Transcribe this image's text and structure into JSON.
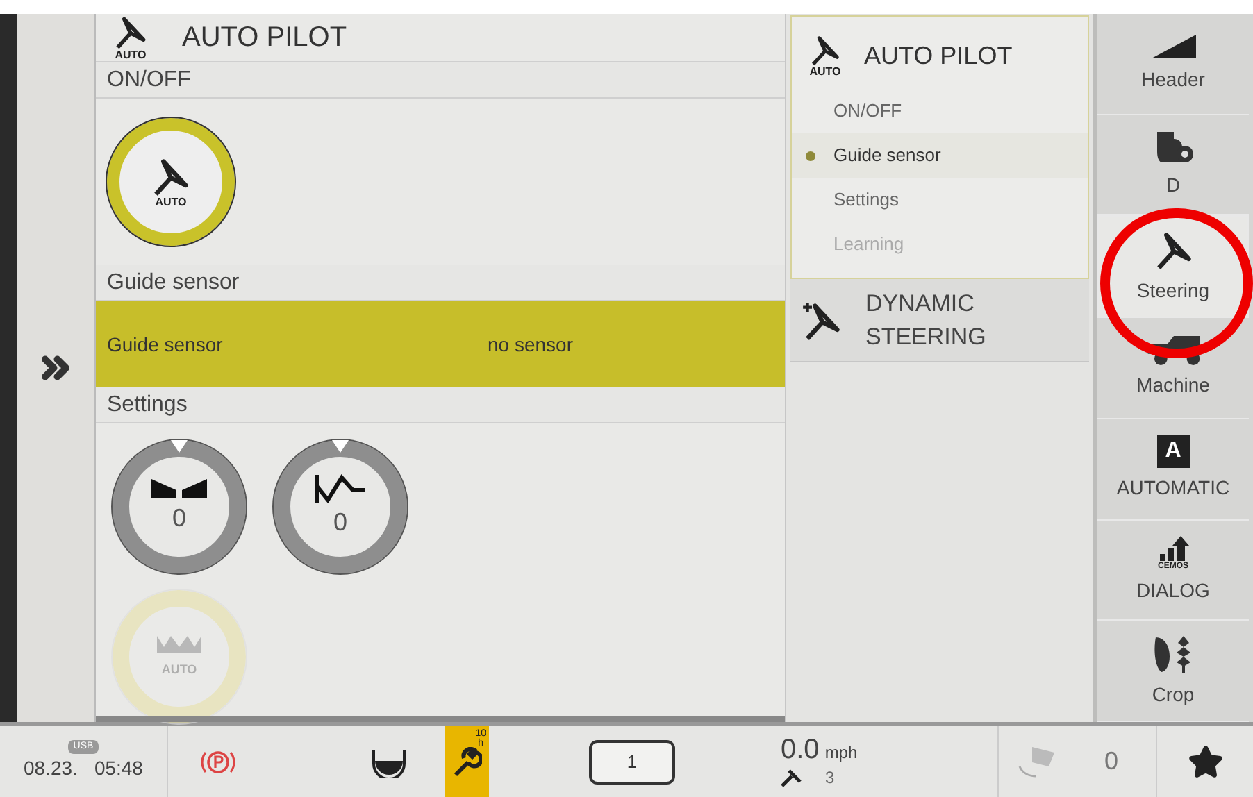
{
  "main_panel": {
    "title": "AUTO PILOT",
    "icon_label": "AUTO",
    "sections": [
      {
        "kind": "toggle",
        "heading": "ON/OFF",
        "icon_label": "AUTO",
        "on": true
      },
      {
        "kind": "field",
        "heading": "Guide sensor",
        "label": "Guide sensor",
        "value": "no sensor",
        "selected": true
      },
      {
        "kind": "dials",
        "heading": "Settings",
        "dials": [
          {
            "kind": "gain",
            "value": "0",
            "disabled": false
          },
          {
            "kind": "wave",
            "value": "0",
            "disabled": false
          },
          {
            "kind": "header-auto",
            "value": "AUTO",
            "disabled": true
          }
        ]
      }
    ]
  },
  "submenu": {
    "title": "AUTO PILOT",
    "icon_label": "AUTO",
    "items": [
      {
        "label": "ON/OFF",
        "selected": false,
        "disabled": false
      },
      {
        "label": "Guide sensor",
        "selected": true,
        "disabled": false
      },
      {
        "label": "Settings",
        "selected": false,
        "disabled": false
      },
      {
        "label": "Learning",
        "selected": false,
        "disabled": true
      }
    ],
    "next": {
      "title": "DYNAMIC STEERING"
    }
  },
  "nav": {
    "items": [
      {
        "kind": "header",
        "label": "Header",
        "selected": false
      },
      {
        "kind": "drive",
        "label": "D",
        "selected": false
      },
      {
        "kind": "steering",
        "label": "Steering",
        "selected": true
      },
      {
        "kind": "machine",
        "label": "Machine",
        "selected": false
      },
      {
        "kind": "automatic",
        "label": "AUTOMATIC",
        "selected": false,
        "icon_text": "A"
      },
      {
        "kind": "dialog",
        "label": "DIALOG",
        "selected": false,
        "icon_text": "CEMOS"
      },
      {
        "kind": "crop",
        "label": "Crop",
        "selected": false
      }
    ]
  },
  "status_bar": {
    "usb": "USB",
    "date": "08.23.",
    "time": "05:48",
    "maintenance_hours": "10",
    "maintenance_unit": "h",
    "gear": "1",
    "speed": "0.0",
    "speed_unit": "mph",
    "steering_count": "3",
    "counter": "0"
  },
  "annotation": {
    "kind": "circle"
  }
}
